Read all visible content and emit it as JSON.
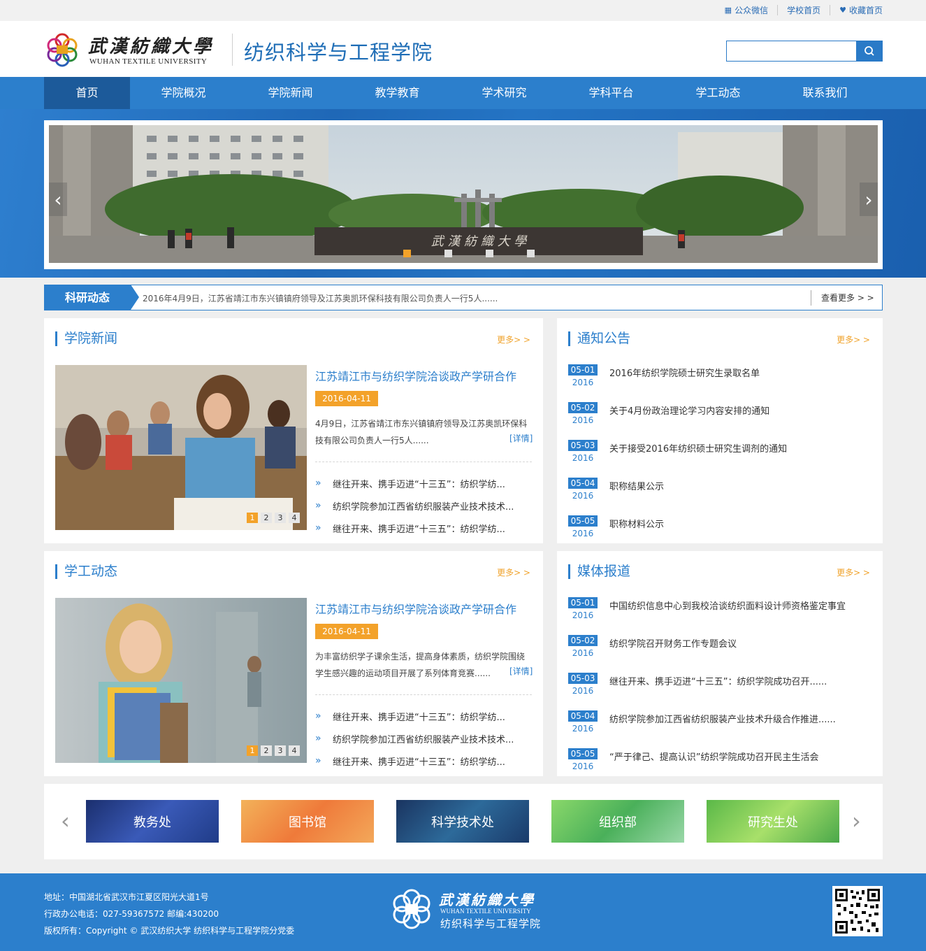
{
  "top_links": [
    {
      "icon": "qr-icon",
      "label": "公众微信"
    },
    {
      "icon": "",
      "label": "学校首页"
    },
    {
      "icon": "heart-icon",
      "label": "收藏首页"
    }
  ],
  "brand": {
    "university_cn": "武漢紡織大學",
    "university_en": "WUHAN TEXTILE UNIVERSITY",
    "college": "纺织科学与工程学院"
  },
  "search": {
    "placeholder": "",
    "value": ""
  },
  "nav": [
    "首页",
    "学院概况",
    "学院新闻",
    "教学教育",
    "学术研究",
    "学科平台",
    "学工动态",
    "联系我们"
  ],
  "banner": {
    "gate_text": "武 漢 紡 織 大 學",
    "slide_count": 4,
    "active_slide": 0
  },
  "ticker": {
    "tag": "科研动态",
    "text": "2016年4月9日，江苏省靖江市东兴镇镇府领导及江苏奥凯环保科技有限公司负责人一行5人......",
    "more": "查看更多  > >"
  },
  "news": {
    "title": "学院新闻",
    "more": "更多> >",
    "feature_title": "江苏靖江市与纺织学院洽谈政产学研合作",
    "feature_date": "2016-04-11",
    "feature_desc": "4月9日，江苏省靖江市东兴镇镇府领导及江苏奥凯环保科技有限公司负责人一行5人......",
    "detail": "[详情]",
    "pages": [
      "1",
      "2",
      "3",
      "4"
    ],
    "items": [
      "继往开来、携手迈进“十三五”：纺织学纺...",
      "纺织学院参加江西省纺织服装产业技术技术...",
      "继往开来、携手迈进“十三五”：纺织学纺..."
    ]
  },
  "notices": {
    "title": "通知公告",
    "more": "更多> >",
    "items": [
      {
        "md": "05-01",
        "year": "2016",
        "text": "2016年纺织学院硕士研究生录取名单"
      },
      {
        "md": "05-02",
        "year": "2016",
        "text": "关于4月份政治理论学习内容安排的通知"
      },
      {
        "md": "05-03",
        "year": "2016",
        "text": "关于接受2016年纺织硕士研究生调剂的通知"
      },
      {
        "md": "05-04",
        "year": "2016",
        "text": "职称结果公示"
      },
      {
        "md": "05-05",
        "year": "2016",
        "text": "职称材料公示"
      }
    ]
  },
  "student": {
    "title": "学工动态",
    "more": "更多> >",
    "feature_title": "江苏靖江市与纺织学院洽谈政产学研合作",
    "feature_date": "2016-04-11",
    "feature_desc": "为丰富纺织学子课余生活，提高身体素质，纺织学院围绕学生感兴趣的运动项目开展了系列体育竞赛......",
    "detail": "[详情]",
    "pages": [
      "1",
      "2",
      "3",
      "4"
    ],
    "items": [
      "继往开来、携手迈进“十三五”：纺织学纺...",
      "纺织学院参加江西省纺织服装产业技术技术...",
      "继往开来、携手迈进“十三五”：纺织学纺..."
    ]
  },
  "media": {
    "title": "媒体报道",
    "more": "更多> >",
    "items": [
      {
        "md": "05-01",
        "year": "2016",
        "text": "中国纺织信息中心到我校洽谈纺织面料设计师资格鉴定事宜"
      },
      {
        "md": "05-02",
        "year": "2016",
        "text": "纺织学院召开财务工作专题会议"
      },
      {
        "md": "05-03",
        "year": "2016",
        "text": "继往开来、携手迈进“十三五”：纺织学院成功召开......"
      },
      {
        "md": "05-04",
        "year": "2016",
        "text": "纺织学院参加江西省纺织服装产业技术升级合作推进......"
      },
      {
        "md": "05-05",
        "year": "2016",
        "text": "“严于律己、提高认识”纺织学院成功召开民主生活会"
      }
    ]
  },
  "quick_links": [
    {
      "label": "教务处",
      "color": "#2c4a9a"
    },
    {
      "label": "图书馆",
      "color": "#ef8a3a"
    },
    {
      "label": "科学技术处",
      "color": "#1f4e86"
    },
    {
      "label": "组织部",
      "color": "#6cc06a"
    },
    {
      "label": "研究生处",
      "color": "#7ccc5a"
    }
  ],
  "footer": {
    "address": "地址：中国湖北省武汉市江夏区阳光大道1号",
    "phone": "行政办公电话：027-59367572  邮编:430200",
    "copyright": "版权所有：Copyright © 武汉纺织大学 纺织科学与工程学院分党委",
    "university_cn": "武漢紡織大學",
    "university_en": "WUHAN TEXTILE UNIVERSITY",
    "college": "纺织科学与工程学院"
  },
  "colors": {
    "primary": "#2c7fcc",
    "nav_active": "#1c5a9a",
    "accent": "#f3a22a"
  }
}
